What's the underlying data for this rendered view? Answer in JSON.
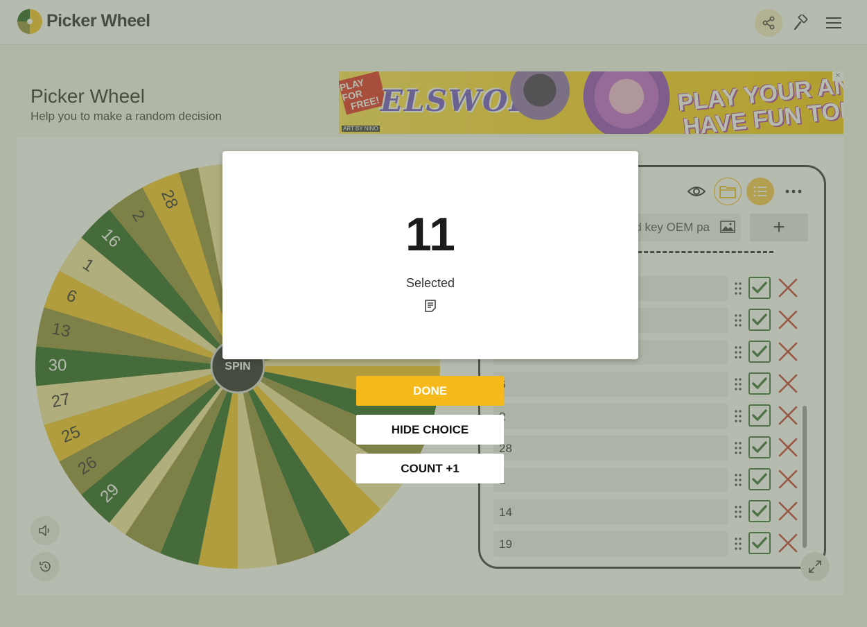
{
  "header": {
    "brand": "Picker Wheel",
    "share_icon": "share-icon",
    "tools_icon": "hammer-icon",
    "menu_icon": "hamburger-menu-icon"
  },
  "page": {
    "title": "Picker Wheel",
    "subtitle": "Help you to make a random decision"
  },
  "ad": {
    "ribbon_line1": "PLAY FOR",
    "ribbon_line2": "FREE!",
    "game": "ELSWORD",
    "headline1": "PLAY YOUR ANIME.",
    "headline2": "HAVE FUN TODAY!",
    "credit": "ART BY NINO"
  },
  "wheel": {
    "spin_label": "SPIN",
    "colors": [
      "#f4c31c",
      "#1f5e17",
      "#8f8a2e",
      "#f3e49a"
    ],
    "visible_segments": [
      {
        "label": "28",
        "color": "#f4c31c"
      },
      {
        "label": "2",
        "color": "#8f8a2e"
      },
      {
        "label": "16",
        "color": "#1f5e17"
      },
      {
        "label": "1",
        "color": "#f3e49a"
      },
      {
        "label": "6",
        "color": "#f4c31c"
      },
      {
        "label": "13",
        "color": "#8f8a2e"
      },
      {
        "label": "30",
        "color": "#1f5e17"
      },
      {
        "label": "27",
        "color": "#f3e49a"
      },
      {
        "label": "25",
        "color": "#f4c31c"
      },
      {
        "label": "26",
        "color": "#8f8a2e"
      },
      {
        "label": "29",
        "color": "#1f5e17"
      }
    ]
  },
  "controls": {
    "sound_icon": "speaker-icon",
    "history_icon": "history-icon",
    "expand_icon": "expand-icon"
  },
  "list_panel": {
    "input_value": "d key OEM pa",
    "image_icon": "image-icon",
    "add_label": "+",
    "view_icon": "eye-icon",
    "folder_icon": "folder-icon",
    "list_icon": "list-icon",
    "more_icon": "more-dots-icon",
    "rows": [
      {
        "text": ""
      },
      {
        "text": ""
      },
      {
        "text": ""
      },
      {
        "text": "6"
      },
      {
        "text": "2"
      },
      {
        "text": "28"
      },
      {
        "text": "1"
      },
      {
        "text": "14"
      },
      {
        "text": "19"
      }
    ]
  },
  "result_modal": {
    "value": "11",
    "label": "Selected",
    "note_icon": "note-icon",
    "done_label": "DONE",
    "hide_label": "HIDE CHOICE",
    "count_label": "COUNT +1"
  }
}
